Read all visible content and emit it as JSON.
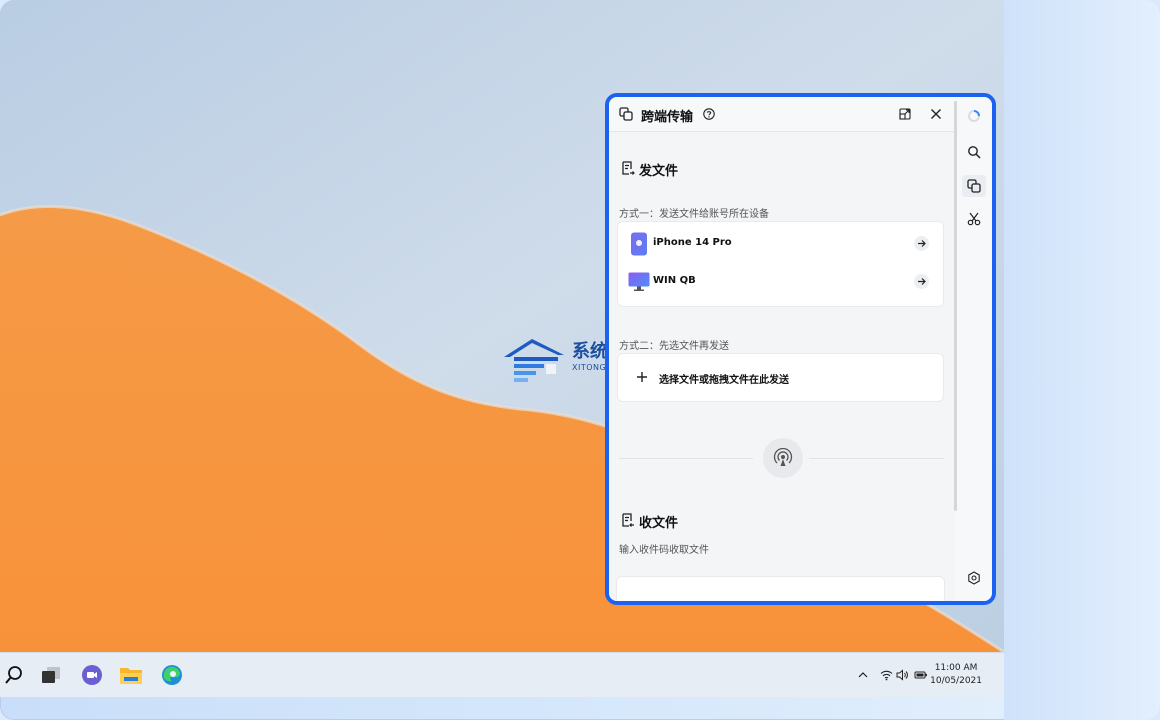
{
  "panel": {
    "title": "跨端传输",
    "send": {
      "heading": "发文件",
      "method1_caption": "方式一：发送文件给账号所在设备",
      "devices": [
        {
          "name": "iPhone 14 Pro",
          "icon": "phone-icon"
        },
        {
          "name": "WIN QB",
          "icon": "monitor-icon"
        }
      ],
      "method2_caption": "方式二：先选文件再发送",
      "select_label": "选择文件或拖拽文件在此发送"
    },
    "receive": {
      "heading": "收文件",
      "caption": "输入收件码收取文件"
    }
  },
  "watermark": {
    "title": "系统之家",
    "subtitle": "XITONGZHIJIA.NET"
  },
  "taskbar": {
    "time": "11:00 AM",
    "date": "10/05/2021"
  },
  "colors": {
    "accent": "#1c62f0",
    "dune": "#f7943e",
    "sky": "#c7d6e8"
  }
}
